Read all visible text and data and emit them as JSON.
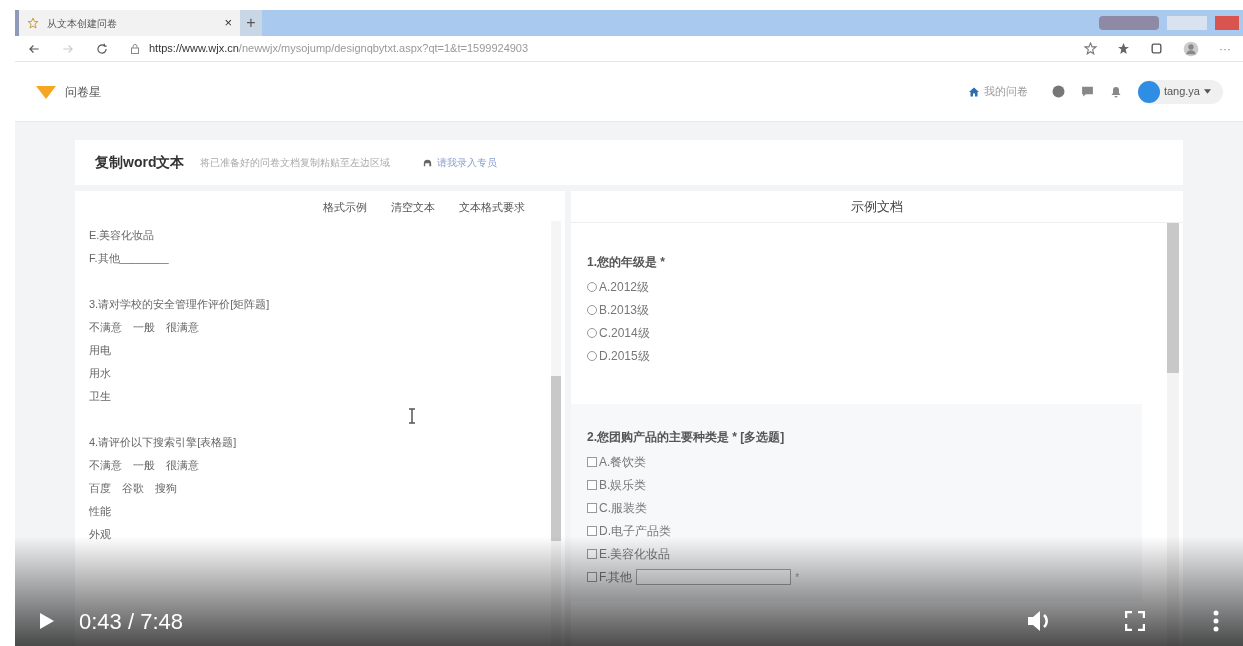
{
  "browser": {
    "tab_title": "从文本创建问卷",
    "tab_close": "×",
    "new_tab": "+",
    "url_host": "https://www.wjx.cn",
    "url_path": "/newwjx/mysojump/designqbytxt.aspx?qt=1&t=1599924903",
    "more": "···"
  },
  "site": {
    "brand": "问卷星",
    "home_link": "我的问卷",
    "user": "tang.ya"
  },
  "header_card": {
    "title": "复制word文本",
    "hint": "将已准备好的问卷文档复制粘贴至左边区域",
    "link": "请我录入专员"
  },
  "editor": {
    "toolbar": [
      "格式示例",
      "清空文本",
      "文本格式要求"
    ],
    "blocks": [
      [
        "E.美容化妆品",
        "F.其他________"
      ],
      [
        "3.请对学校的安全管理作评价[矩阵题]",
        "不满意　一般　很满意",
        "用电",
        "用水",
        "卫生"
      ],
      [
        "4.请评价以下搜索引擎[表格题]",
        "不满意　一般　很满意",
        "百度　谷歌　搜狗",
        "性能",
        "外观"
      ]
    ]
  },
  "sample": {
    "title": "示例文档",
    "questions": [
      {
        "kind": "radio",
        "title": "1.您的年级是 *",
        "options": [
          {
            "label": "A.2012级",
            "checked": false
          },
          {
            "label": "B.2013级",
            "checked": false
          },
          {
            "label": "C.2014级",
            "checked": false
          },
          {
            "label": "D.2015级",
            "checked": false
          }
        ]
      },
      {
        "kind": "checkbox",
        "title": "2.您团购产品的主要种类是 * [多选题]",
        "options": [
          {
            "label": "A.餐饮类",
            "checked": false
          },
          {
            "label": "B.娱乐类",
            "checked": false
          },
          {
            "label": "C.服装类",
            "checked": false
          },
          {
            "label": "D.电子产品类",
            "checked": false
          },
          {
            "label": "E.美容化妆品",
            "checked": false
          },
          {
            "label": "F.其他",
            "checked": false
          }
        ],
        "other_mark": "*"
      }
    ]
  },
  "player": {
    "time": "0:43 / 7:48"
  }
}
